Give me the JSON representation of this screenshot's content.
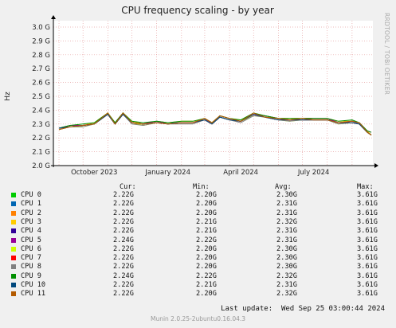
{
  "chart_data": {
    "type": "line",
    "title": "CPU frequency scaling - by year",
    "ylabel": "Hz",
    "ylim": [
      2.0,
      3.0
    ],
    "yticks": [
      "3.0 G",
      "2.9 G",
      "2.8 G",
      "2.7 G",
      "2.6 G",
      "2.5 G",
      "2.4 G",
      "2.3 G",
      "2.2 G",
      "2.1 G",
      "2.0 G"
    ],
    "xticks": [
      "October 2023",
      "January 2024",
      "April 2024",
      "July 2024"
    ],
    "grid": true,
    "x": [
      "2023-09-01",
      "2023-09-15",
      "2023-10-01",
      "2023-10-15",
      "2023-11-01",
      "2023-11-10",
      "2023-11-20",
      "2023-12-01",
      "2023-12-15",
      "2024-01-01",
      "2024-01-15",
      "2024-02-01",
      "2024-02-15",
      "2024-03-01",
      "2024-03-10",
      "2024-03-20",
      "2024-04-01",
      "2024-04-15",
      "2024-05-01",
      "2024-05-15",
      "2024-06-01",
      "2024-06-15",
      "2024-07-01",
      "2024-07-15",
      "2024-08-01",
      "2024-08-15",
      "2024-09-01",
      "2024-09-10",
      "2024-09-20",
      "2024-09-25"
    ],
    "series": [
      {
        "name": "CPU 0",
        "color": "#00cc00",
        "values": [
          2.27,
          2.29,
          2.29,
          2.3,
          2.37,
          2.3,
          2.38,
          2.31,
          2.3,
          2.32,
          2.3,
          2.31,
          2.31,
          2.34,
          2.3,
          2.36,
          2.34,
          2.32,
          2.37,
          2.36,
          2.34,
          2.33,
          2.34,
          2.34,
          2.34,
          2.31,
          2.32,
          2.31,
          2.24,
          2.22
        ]
      },
      {
        "name": "CPU 1",
        "color": "#0066b3",
        "values": [
          2.27,
          2.28,
          2.29,
          2.3,
          2.37,
          2.3,
          2.37,
          2.31,
          2.3,
          2.32,
          2.31,
          2.31,
          2.31,
          2.33,
          2.3,
          2.35,
          2.33,
          2.32,
          2.37,
          2.35,
          2.33,
          2.33,
          2.33,
          2.33,
          2.33,
          2.31,
          2.32,
          2.3,
          2.25,
          2.22
        ]
      },
      {
        "name": "CPU 2",
        "color": "#ff8000",
        "values": [
          2.26,
          2.28,
          2.29,
          2.3,
          2.38,
          2.3,
          2.38,
          2.31,
          2.29,
          2.31,
          2.3,
          2.31,
          2.31,
          2.34,
          2.31,
          2.36,
          2.34,
          2.32,
          2.38,
          2.35,
          2.34,
          2.33,
          2.34,
          2.33,
          2.33,
          2.31,
          2.32,
          2.31,
          2.24,
          2.22
        ]
      },
      {
        "name": "CPU 3",
        "color": "#ffcc00",
        "values": [
          2.27,
          2.29,
          2.29,
          2.31,
          2.38,
          2.31,
          2.38,
          2.32,
          2.3,
          2.32,
          2.31,
          2.32,
          2.32,
          2.34,
          2.31,
          2.36,
          2.34,
          2.33,
          2.37,
          2.36,
          2.34,
          2.34,
          2.34,
          2.34,
          2.34,
          2.32,
          2.32,
          2.31,
          2.25,
          2.22
        ]
      },
      {
        "name": "CPU 4",
        "color": "#330099",
        "values": [
          2.27,
          2.28,
          2.29,
          2.3,
          2.37,
          2.3,
          2.37,
          2.31,
          2.3,
          2.31,
          2.3,
          2.31,
          2.31,
          2.33,
          2.3,
          2.35,
          2.33,
          2.32,
          2.37,
          2.35,
          2.33,
          2.33,
          2.33,
          2.33,
          2.33,
          2.31,
          2.31,
          2.3,
          2.24,
          2.22
        ]
      },
      {
        "name": "CPU 5",
        "color": "#990099",
        "values": [
          2.27,
          2.29,
          2.29,
          2.3,
          2.37,
          2.31,
          2.38,
          2.31,
          2.3,
          2.32,
          2.3,
          2.31,
          2.31,
          2.34,
          2.3,
          2.36,
          2.34,
          2.32,
          2.37,
          2.36,
          2.34,
          2.33,
          2.34,
          2.34,
          2.34,
          2.31,
          2.32,
          2.31,
          2.25,
          2.24
        ]
      },
      {
        "name": "CPU 6",
        "color": "#ccff00",
        "values": [
          2.26,
          2.28,
          2.28,
          2.3,
          2.37,
          2.3,
          2.37,
          2.31,
          2.29,
          2.31,
          2.3,
          2.31,
          2.31,
          2.33,
          2.3,
          2.35,
          2.33,
          2.32,
          2.36,
          2.35,
          2.33,
          2.32,
          2.33,
          2.33,
          2.33,
          2.3,
          2.31,
          2.3,
          2.24,
          2.22
        ]
      },
      {
        "name": "CPU 7",
        "color": "#ff0000",
        "values": [
          2.27,
          2.28,
          2.29,
          2.3,
          2.37,
          2.3,
          2.37,
          2.31,
          2.3,
          2.31,
          2.3,
          2.31,
          2.31,
          2.33,
          2.3,
          2.35,
          2.33,
          2.32,
          2.37,
          2.35,
          2.33,
          2.33,
          2.33,
          2.33,
          2.33,
          2.31,
          2.31,
          2.3,
          2.24,
          2.22
        ]
      },
      {
        "name": "CPU 8",
        "color": "#808080",
        "values": [
          2.26,
          2.28,
          2.28,
          2.3,
          2.37,
          2.3,
          2.37,
          2.3,
          2.29,
          2.31,
          2.3,
          2.3,
          2.3,
          2.33,
          2.3,
          2.35,
          2.33,
          2.31,
          2.36,
          2.35,
          2.33,
          2.32,
          2.33,
          2.33,
          2.33,
          2.3,
          2.31,
          2.3,
          2.24,
          2.22
        ]
      },
      {
        "name": "CPU 9",
        "color": "#008f00",
        "values": [
          2.27,
          2.29,
          2.3,
          2.31,
          2.38,
          2.31,
          2.38,
          2.32,
          2.31,
          2.32,
          2.31,
          2.32,
          2.32,
          2.34,
          2.31,
          2.36,
          2.34,
          2.33,
          2.38,
          2.36,
          2.34,
          2.34,
          2.34,
          2.34,
          2.34,
          2.32,
          2.33,
          2.31,
          2.25,
          2.24
        ]
      },
      {
        "name": "CPU 10",
        "color": "#00487d",
        "values": [
          2.27,
          2.28,
          2.29,
          2.3,
          2.37,
          2.3,
          2.37,
          2.31,
          2.3,
          2.31,
          2.3,
          2.31,
          2.31,
          2.33,
          2.3,
          2.35,
          2.33,
          2.32,
          2.37,
          2.35,
          2.33,
          2.33,
          2.33,
          2.33,
          2.33,
          2.31,
          2.31,
          2.3,
          2.24,
          2.22
        ]
      },
      {
        "name": "CPU 11",
        "color": "#b35a00",
        "values": [
          2.26,
          2.28,
          2.29,
          2.3,
          2.38,
          2.3,
          2.38,
          2.31,
          2.3,
          2.31,
          2.3,
          2.31,
          2.31,
          2.34,
          2.31,
          2.36,
          2.34,
          2.32,
          2.38,
          2.35,
          2.34,
          2.33,
          2.34,
          2.33,
          2.33,
          2.31,
          2.32,
          2.31,
          2.24,
          2.22
        ]
      }
    ]
  },
  "legend": {
    "headers": {
      "cur": "Cur:",
      "min": "Min:",
      "avg": "Avg:",
      "max": "Max:"
    },
    "rows": [
      {
        "name": "CPU 0",
        "color": "#00cc00",
        "cur": "2.22G",
        "min": "2.20G",
        "avg": "2.30G",
        "max": "3.61G"
      },
      {
        "name": "CPU 1",
        "color": "#0066b3",
        "cur": "2.22G",
        "min": "2.20G",
        "avg": "2.31G",
        "max": "3.61G"
      },
      {
        "name": "CPU 2",
        "color": "#ff8000",
        "cur": "2.22G",
        "min": "2.20G",
        "avg": "2.31G",
        "max": "3.61G"
      },
      {
        "name": "CPU 3",
        "color": "#ffcc00",
        "cur": "2.22G",
        "min": "2.21G",
        "avg": "2.32G",
        "max": "3.61G"
      },
      {
        "name": "CPU 4",
        "color": "#330099",
        "cur": "2.22G",
        "min": "2.21G",
        "avg": "2.31G",
        "max": "3.61G"
      },
      {
        "name": "CPU 5",
        "color": "#990099",
        "cur": "2.24G",
        "min": "2.22G",
        "avg": "2.31G",
        "max": "3.61G"
      },
      {
        "name": "CPU 6",
        "color": "#ccff00",
        "cur": "2.22G",
        "min": "2.20G",
        "avg": "2.30G",
        "max": "3.61G"
      },
      {
        "name": "CPU 7",
        "color": "#ff0000",
        "cur": "2.22G",
        "min": "2.20G",
        "avg": "2.30G",
        "max": "3.61G"
      },
      {
        "name": "CPU 8",
        "color": "#808080",
        "cur": "2.22G",
        "min": "2.20G",
        "avg": "2.30G",
        "max": "3.61G"
      },
      {
        "name": "CPU 9",
        "color": "#008f00",
        "cur": "2.24G",
        "min": "2.22G",
        "avg": "2.32G",
        "max": "3.61G"
      },
      {
        "name": "CPU 10",
        "color": "#00487d",
        "cur": "2.22G",
        "min": "2.21G",
        "avg": "2.31G",
        "max": "3.61G"
      },
      {
        "name": "CPU 11",
        "color": "#b35a00",
        "cur": "2.22G",
        "min": "2.20G",
        "avg": "2.32G",
        "max": "3.61G"
      }
    ]
  },
  "last_update": "Last update:  Wed Sep 25 03:00:44 2024",
  "footer": "Munin 2.0.25-2ubuntu0.16.04.3",
  "side_label": "RRDTOOL / TOBI OETIKER",
  "colors": {
    "background": "#f0f0f0",
    "plot_bg": "#ffffff",
    "grid": "#e6a3a3",
    "axis": "#000000"
  }
}
